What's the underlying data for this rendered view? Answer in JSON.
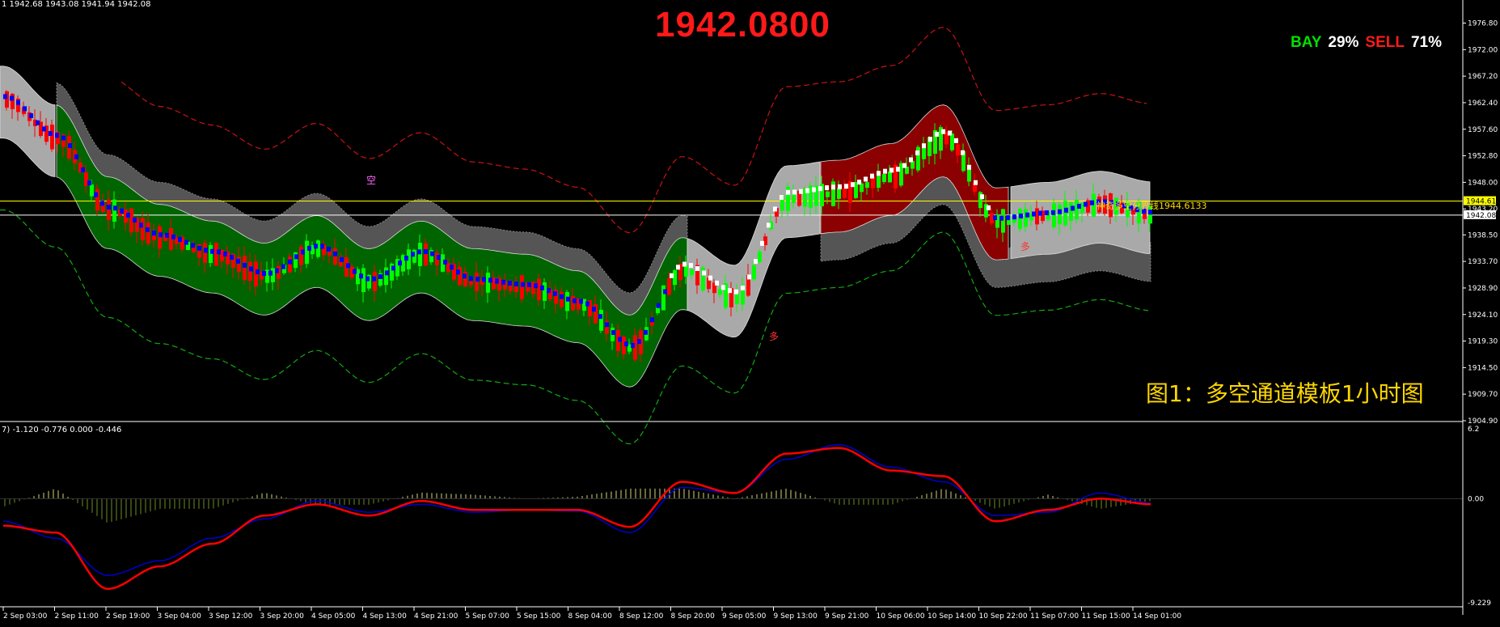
{
  "header": {
    "ohlc": "1  1942.68 1943.08 1941.94 1942.08",
    "current_price": "1942.0800",
    "bay_label": "BAY",
    "bay_pct": "29%",
    "sell_label": "SELL",
    "sell_pct": "71%",
    "caption": "图1：多空通道模板1小时图",
    "boundary_label": "神奇多空分界线1944.6133",
    "macd_info": "7) -1.120 -0.776 0.000 -0.446",
    "tag_bull": "多",
    "tag_bear": "空"
  },
  "colors": {
    "background": "#000000",
    "bull_candle": "#00ff00",
    "bear_candle": "#ff0000",
    "channel_bull": "#006400",
    "channel_bear": "#8b0000",
    "channel_neutral": "#a9a9a9",
    "trend_line_down": "#0000ff",
    "trend_line_up": "#ffffff",
    "macd_line": "#ff0000",
    "signal_line": "#0000cd",
    "histogram": "#d4d47a",
    "price_line": "#ffff00",
    "accent_text": "#ffd700"
  },
  "chart_data": [
    {
      "type": "candlestick",
      "title": "",
      "ylim": [
        1904.9,
        1979.8
      ],
      "y_ticks": [
        "1976.80",
        "1972.00",
        "1967.20",
        "1962.40",
        "1957.60",
        "1952.80",
        "1948.00",
        "1943.20",
        "1938.50",
        "1933.70",
        "1928.90",
        "1924.10",
        "1919.30",
        "1914.50",
        "1909.70",
        "1904.90"
      ],
      "price_markers": [
        {
          "label": "1944.61",
          "value": 1944.61,
          "color": "#ffff00"
        },
        {
          "label": "1942.08",
          "value": 1942.08,
          "color": "#ffffff"
        }
      ],
      "x_labels": [
        "2 Sep 03:00",
        "2 Sep 11:00",
        "2 Sep 19:00",
        "3 Sep 04:00",
        "3 Sep 12:00",
        "3 Sep 20:00",
        "4 Sep 05:00",
        "4 Sep 13:00",
        "4 Sep 21:00",
        "5 Sep 07:00",
        "5 Sep 15:00",
        "8 Sep 04:00",
        "8 Sep 12:00",
        "8 Sep 20:00",
        "9 Sep 05:00",
        "9 Sep 13:00",
        "9 Sep 21:00",
        "10 Sep 06:00",
        "10 Sep 14:00",
        "10 Sep 22:00",
        "11 Sep 07:00",
        "11 Sep 15:00",
        "14 Sep 01:00"
      ],
      "key_points": [
        {
          "x": "2 Sep 03:00",
          "close": 1963
        },
        {
          "x": "2 Sep 11:00",
          "close": 1956
        },
        {
          "x": "2 Sep 19:00",
          "close": 1943
        },
        {
          "x": "3 Sep 04:00",
          "close": 1938
        },
        {
          "x": "3 Sep 12:00",
          "close": 1935
        },
        {
          "x": "3 Sep 20:00",
          "close": 1931
        },
        {
          "x": "4 Sep 05:00",
          "close": 1936
        },
        {
          "x": "4 Sep 13:00",
          "close": 1930
        },
        {
          "x": "4 Sep 21:00",
          "close": 1935
        },
        {
          "x": "5 Sep 07:00",
          "close": 1930
        },
        {
          "x": "5 Sep 15:00",
          "close": 1929
        },
        {
          "x": "8 Sep 04:00",
          "close": 1926
        },
        {
          "x": "8 Sep 12:00",
          "close": 1918
        },
        {
          "x": "8 Sep 20:00",
          "close": 1932
        },
        {
          "x": "9 Sep 05:00",
          "close": 1927
        },
        {
          "x": "9 Sep 13:00",
          "close": 1945
        },
        {
          "x": "9 Sep 21:00",
          "close": 1946
        },
        {
          "x": "10 Sep 06:00",
          "close": 1949
        },
        {
          "x": "10 Sep 14:00",
          "close": 1956
        },
        {
          "x": "10 Sep 22:00",
          "close": 1941
        },
        {
          "x": "11 Sep 07:00",
          "close": 1942
        },
        {
          "x": "11 Sep 15:00",
          "close": 1944
        },
        {
          "x": "14 Sep 01:00",
          "close": 1942.08
        }
      ]
    },
    {
      "type": "line",
      "title": "",
      "ylim": [
        -9.229,
        6.2
      ],
      "y_ticks": [
        "6.2",
        "0.00",
        "-9.229"
      ],
      "series": [
        {
          "values": [
            -2.4,
            -3.0,
            -8.0,
            -6.0,
            -4.0,
            -1.5,
            -0.5,
            -1.5,
            -0.2,
            -1.0,
            -1.0,
            -1.0,
            -2.5,
            1.5,
            0.5,
            4.0,
            4.5,
            2.5,
            2.0,
            -2.0,
            -1.0,
            0.0,
            -0.5
          ]
        },
        {
          "values": [
            -2.0,
            -3.5,
            -6.8,
            -5.5,
            -3.5,
            -1.8,
            -0.2,
            -1.2,
            -0.5,
            -1.2,
            -1.0,
            -1.1,
            -3.0,
            1.0,
            0.5,
            3.5,
            4.8,
            2.8,
            1.5,
            -1.5,
            -1.2,
            0.5,
            -0.4
          ]
        }
      ]
    }
  ]
}
